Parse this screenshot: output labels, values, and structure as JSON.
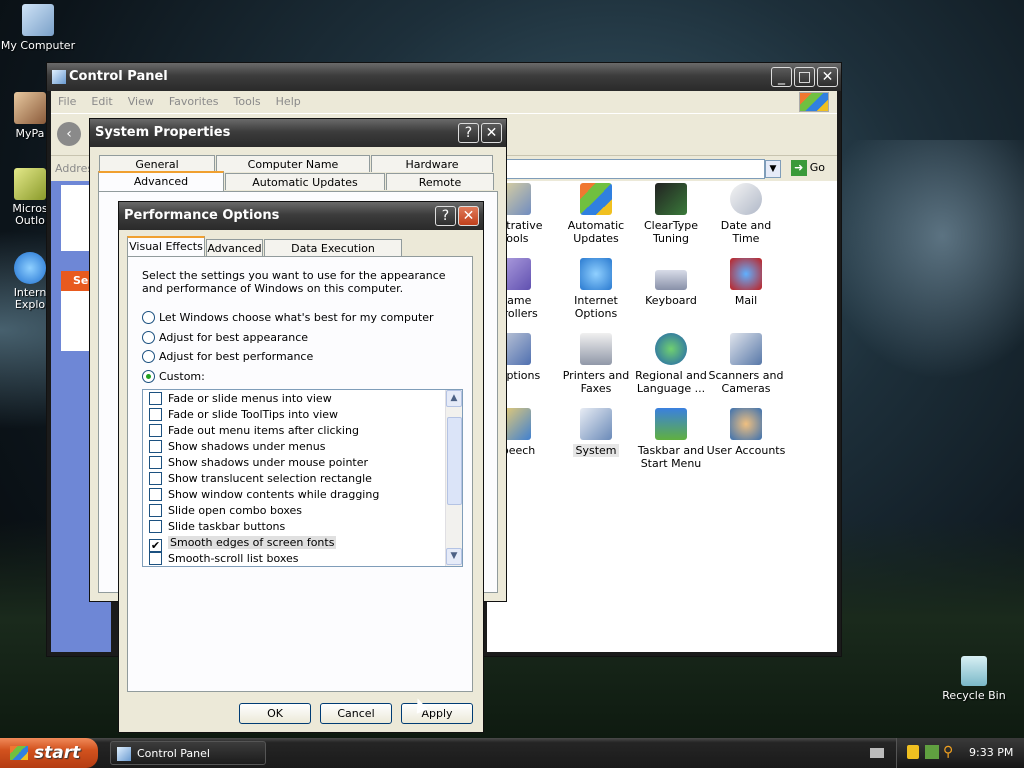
{
  "desktop": {
    "icons": [
      {
        "label": "My Computer"
      },
      {
        "label": "MyPa"
      },
      {
        "label": "Micros Outlo"
      },
      {
        "label": "Intern Explo"
      },
      {
        "label": "Recycle Bin"
      }
    ]
  },
  "control_panel": {
    "title": "Control Panel",
    "menu": [
      "File",
      "Edit",
      "View",
      "Favorites",
      "Tools",
      "Help"
    ],
    "address_label": "Addres",
    "go_label": "Go",
    "side_label": "Se",
    "items": [
      {
        "label": "inistrative Tools"
      },
      {
        "label": "Automatic Updates"
      },
      {
        "label": "ClearType Tuning"
      },
      {
        "label": "Date and Time"
      },
      {
        "label": "Game ntrollers"
      },
      {
        "label": "Internet Options"
      },
      {
        "label": "Keyboard"
      },
      {
        "label": "Mail"
      },
      {
        "label": "r Options"
      },
      {
        "label": "Printers and Faxes"
      },
      {
        "label": "Regional and Language ..."
      },
      {
        "label": "Scanners and Cameras"
      },
      {
        "label": "Speech"
      },
      {
        "label": "System"
      },
      {
        "label": "Taskbar and Start Menu"
      },
      {
        "label": "User Accounts"
      }
    ]
  },
  "system_properties": {
    "title": "System Properties",
    "tabs_row1": [
      "General",
      "Computer Name",
      "Hardware"
    ],
    "tabs_row2": [
      "Advanced",
      "Automatic Updates",
      "Remote"
    ]
  },
  "performance_options": {
    "title": "Performance Options",
    "tabs": [
      "Visual Effects",
      "Advanced",
      "Data Execution Prevention"
    ],
    "description": "Select the settings you want to use for the appearance and performance of Windows on this computer.",
    "radios": [
      {
        "label": "Let Windows choose what's best for my computer",
        "checked": false
      },
      {
        "label": "Adjust for best appearance",
        "checked": false
      },
      {
        "label": "Adjust for best performance",
        "checked": false
      },
      {
        "label": "Custom:",
        "checked": true
      }
    ],
    "effects": [
      {
        "label": "Fade or slide menus into view",
        "checked": false
      },
      {
        "label": "Fade or slide ToolTips into view",
        "checked": false
      },
      {
        "label": "Fade out menu items after clicking",
        "checked": false
      },
      {
        "label": "Show shadows under menus",
        "checked": false
      },
      {
        "label": "Show shadows under mouse pointer",
        "checked": false
      },
      {
        "label": "Show translucent selection rectangle",
        "checked": false
      },
      {
        "label": "Show window contents while dragging",
        "checked": false
      },
      {
        "label": "Slide open combo boxes",
        "checked": false
      },
      {
        "label": "Slide taskbar buttons",
        "checked": false
      },
      {
        "label": "Smooth edges of screen fonts",
        "checked": true
      },
      {
        "label": "Smooth-scroll list boxes",
        "checked": false
      }
    ],
    "buttons": {
      "ok": "OK",
      "cancel": "Cancel",
      "apply": "Apply"
    }
  },
  "taskbar": {
    "start_label": "start",
    "task_label": "Control Panel",
    "clock": "9:33 PM"
  },
  "colors": {
    "start_button": "#d2521e",
    "xp_blue": "#6e87d6",
    "checkbox_check": "#21a121"
  }
}
